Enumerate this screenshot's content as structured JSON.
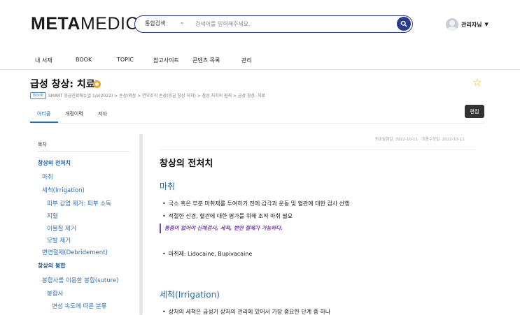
{
  "header": {
    "logo": {
      "bold": "META",
      "light": "MEDIC"
    },
    "search": {
      "scope": "통합검색",
      "placeholder": "검색어를 입력해주세요.",
      "value": ""
    },
    "user": {
      "name": "관리자님"
    }
  },
  "nav": {
    "items": [
      "내 서재",
      "BOOK",
      "TOPIC",
      "참고사이트",
      "콘텐츠 목록",
      "관리"
    ]
  },
  "page": {
    "title": "급성 창상: 치료",
    "book_tag": "Book",
    "breadcrumb": "SMART 응급진료매뉴얼 1/e(2022) > 손상/외상 > 연부조직 손상(응급 창상 처치) > 창상 처치의 원칙 > 급성 창상: 치료"
  },
  "tabs": [
    "아티클",
    "개정이력",
    "저자"
  ],
  "edit_label": "편집",
  "toc": {
    "heading": "목차",
    "items": [
      {
        "label": "창상의 전처치",
        "level": 1
      },
      {
        "label": "마취",
        "level": 2
      },
      {
        "label": "세척(Irrigation)",
        "level": 2
      },
      {
        "label": "피부 감염 제거: 피부 소독",
        "level": 3
      },
      {
        "label": "지혈",
        "level": 3
      },
      {
        "label": "이물질 제거",
        "level": 3
      },
      {
        "label": "모발 제거",
        "level": 3
      },
      {
        "label": "변연절제(Debridement)",
        "level": 2
      },
      {
        "label": "창상의 봉합",
        "level": 1
      },
      {
        "label": "봉합사를 이용한 봉합(suture)",
        "level": 2
      },
      {
        "label": "봉합사",
        "level": 3
      },
      {
        "label": "변성 속도에 따른 분류",
        "level": 4
      }
    ]
  },
  "main": {
    "first_published": "최초발행일: 2022-10-11",
    "last_modified": "최종수정일: 2022-10-11",
    "section_title": "창상의 전처치",
    "subsections": [
      {
        "title": "마취",
        "bullets": [
          "국소 혹은 부분 마취제를 투여하기 전에 감각과 운동 및 혈관에 대한 검사 선행",
          "적절한 신경, 혈관에 대한 평가를 위해 조직 마취 필요"
        ],
        "note": "통증이 없어야 신체검사, 세척, 변연 절제가 가능하다.",
        "extra_bullets": [
          "마취제: Lidocaine, Bupivacaine"
        ]
      },
      {
        "title": "세척(Irrigation)",
        "bullets": [
          "상처의 세척은 급성기 상처의 관리에 있어서 가장 중요한 단계 중 하나"
        ]
      }
    ]
  }
}
